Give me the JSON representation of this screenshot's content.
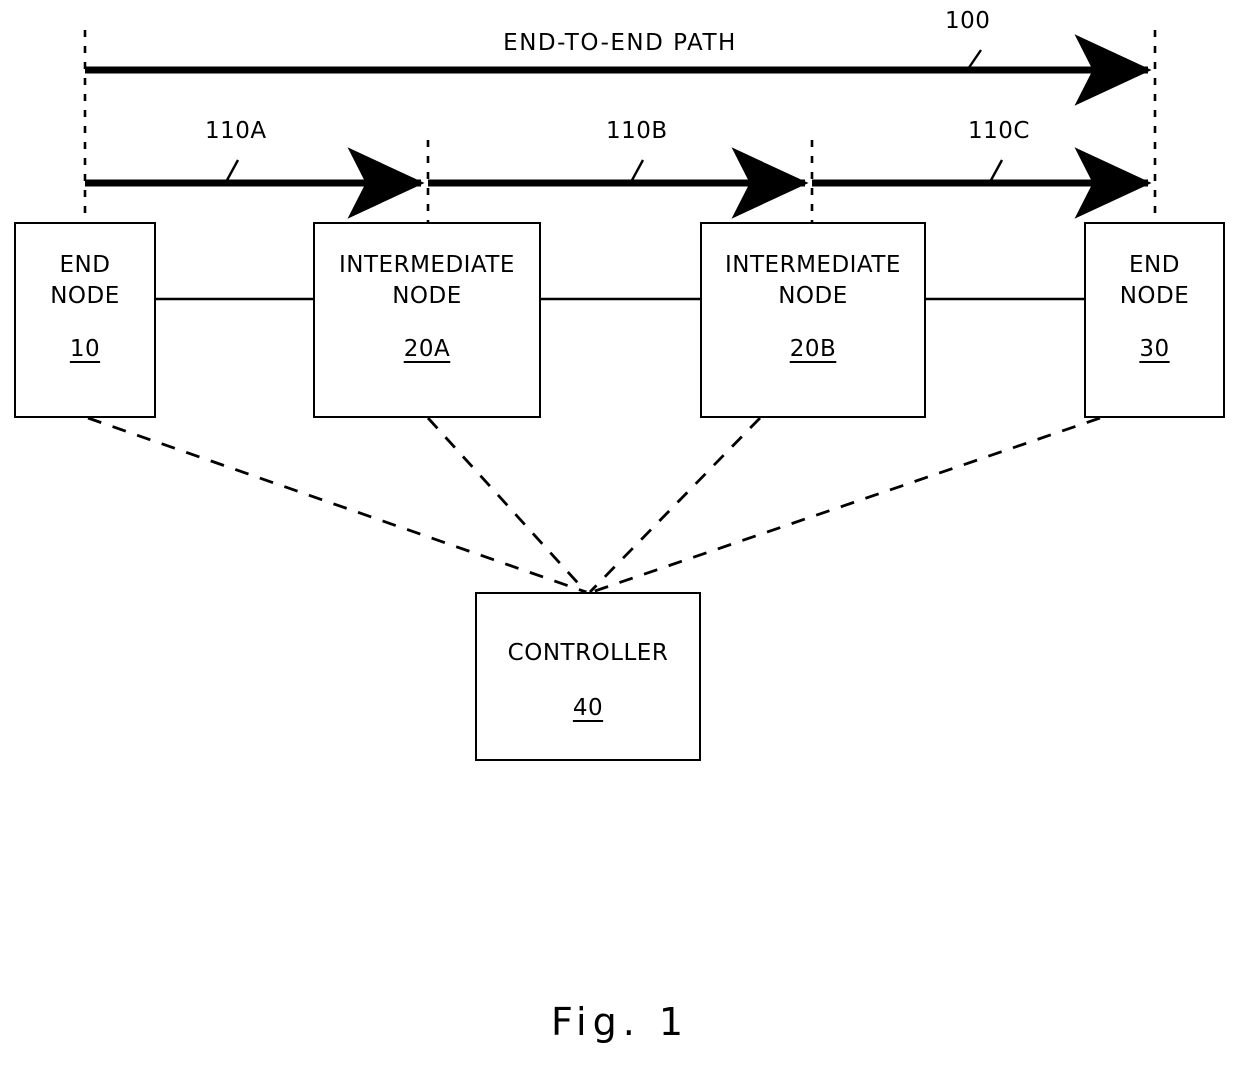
{
  "figure": {
    "caption": "Fig. 1",
    "reference_numeral": "100"
  },
  "paths": {
    "end_to_end": {
      "label": "END-TO-END PATH",
      "ref": "100"
    },
    "segments": [
      {
        "ref": "110A"
      },
      {
        "ref": "110B"
      },
      {
        "ref": "110C"
      }
    ]
  },
  "nodes": [
    {
      "title": "END\nNODE",
      "ref": "10"
    },
    {
      "title": "INTERMEDIATE\nNODE",
      "ref": "20A"
    },
    {
      "title": "INTERMEDIATE\nNODE",
      "ref": "20B"
    },
    {
      "title": "END\nNODE",
      "ref": "30"
    }
  ],
  "controller": {
    "title": "CONTROLLER",
    "ref": "40"
  },
  "colors": {
    "ink": "#000000",
    "paper": "#ffffff"
  }
}
